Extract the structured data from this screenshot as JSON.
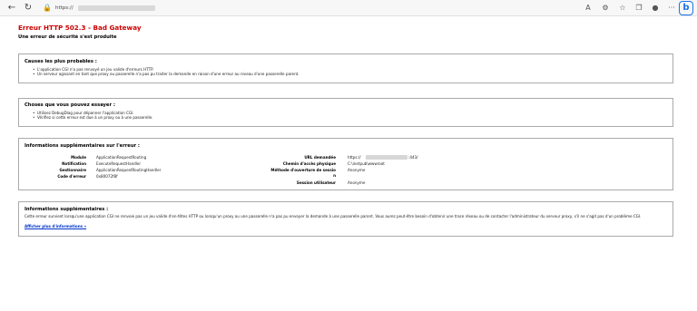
{
  "browser": {
    "url": "https://",
    "icons": [
      "back-icon",
      "refresh-icon",
      "lock-icon"
    ],
    "right_icons": [
      "read-aloud-icon",
      "extensions-icon",
      "favorites-icon",
      "collections-icon",
      "profile-icon",
      "more-icon",
      "bing-icon"
    ]
  },
  "page": {
    "title": "Erreur HTTP 502.3 - Bad Gateway",
    "subtitle": "Une erreur de sécurité s'est produite",
    "title_color": "#cc0000"
  },
  "causes": {
    "heading": "Causes les plus probables :",
    "items": [
      "L'application CGI n'a pas renvoyé un jeu valide d'erreurs HTTP.",
      "Un serveur agissant en tant que proxy ou passerelle n'a pas pu traiter la demande en raison d'une erreur au niveau d'une passerelle parent."
    ]
  },
  "try": {
    "heading": "Choses que vous pouvez essayer :",
    "items": [
      "Utilisez DebugDiag pour dépanner l'application CGI.",
      "Vérifiez si cette erreur est due à un proxy ou à une passerelle."
    ]
  },
  "error_info": {
    "heading": "Informations supplémentaires sur l'erreur :",
    "left": [
      {
        "label": "Module",
        "value": "ApplicationRequestRouting"
      },
      {
        "label": "Notification",
        "value": "ExecuteRequestHandler"
      },
      {
        "label": "Gestionnaire",
        "value": "ApplicationRequestRoutingHandler"
      },
      {
        "label": "Code d'erreur",
        "value": "0x80072f8f"
      }
    ],
    "right": [
      {
        "label": "URL demandée",
        "value": "https://",
        "suffix": ":443/"
      },
      {
        "label": "Chemin d'accès physique",
        "value": "C:\\inetpub\\wwwroot"
      },
      {
        "label": "Méthode d'ouverture de sessio",
        "label_cont": "n",
        "value": "Anonyme"
      },
      {
        "label": "Session utilisateur",
        "value": "Anonyme"
      }
    ]
  },
  "more_info": {
    "heading": "Informations supplémentaires :",
    "paragraph": "Cette erreur survient lorsqu'une application CGI ne renvoie pas un jeu valide d'en-têtes HTTP ou lorsqu'un proxy ou une passerelle n'a pas pu envoyer la demande à une passerelle parent. Vous aurez peut-être besoin d'obtenir une trace réseau ou de contacter l'administrateur du serveur proxy, s'il ne s'agit pas d'un problème CGI.",
    "link": "Afficher plus d'informations »"
  }
}
